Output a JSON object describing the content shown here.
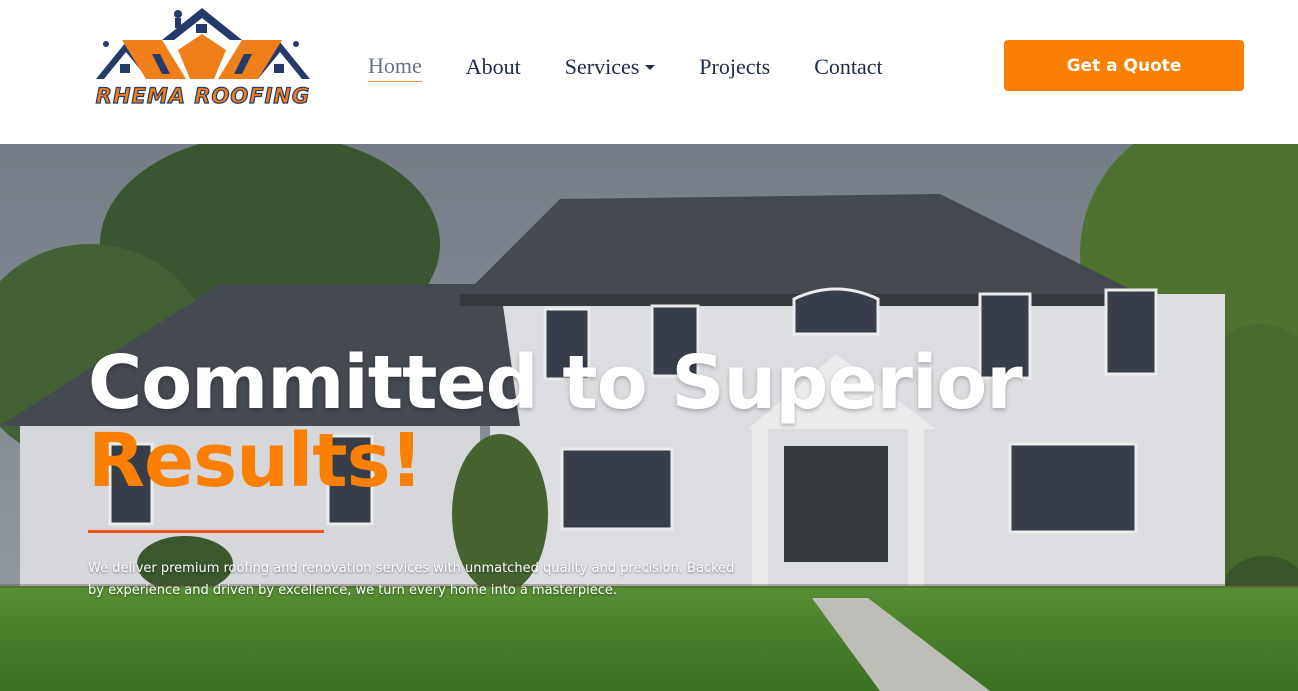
{
  "brand": {
    "name": "RHEMA ROOFING",
    "colors": {
      "orange": "#fb7f00",
      "navy": "#233a6b"
    }
  },
  "nav": {
    "items": [
      {
        "label": "Home",
        "active": true
      },
      {
        "label": "About",
        "active": false
      },
      {
        "label": "Services",
        "active": false,
        "has_dropdown": true
      },
      {
        "label": "Projects",
        "active": false
      },
      {
        "label": "Contact",
        "active": false
      }
    ]
  },
  "header": {
    "cta_label": "Get a Quote"
  },
  "hero": {
    "title": "Committed to Superior",
    "title_accent": "Results!",
    "description": "We deliver premium roofing and renovation services with unmatched quality and precision. Backed by experience and driven by excellence, we turn every home into a masterpiece.",
    "background_image": "white-brick-two-story-house-with-gray-shingle-roof"
  }
}
